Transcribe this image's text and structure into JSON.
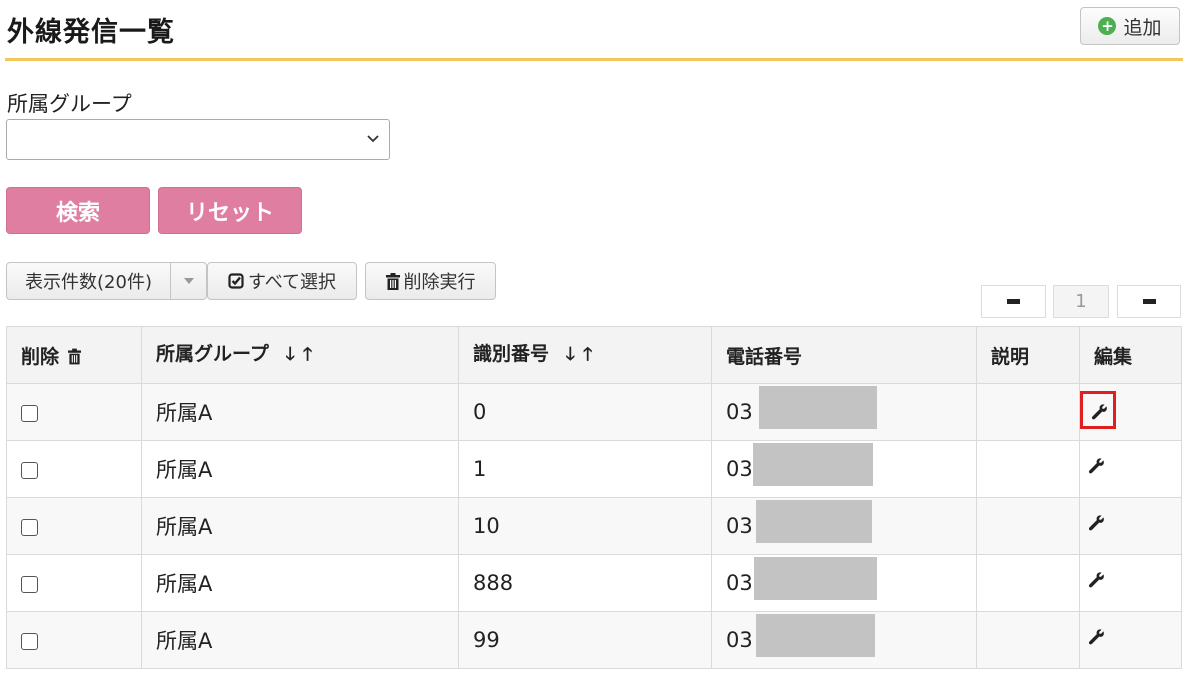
{
  "header": {
    "title": "外線発信一覧",
    "add_label": "追加"
  },
  "filter": {
    "group_label": "所属グループ",
    "group_value": ""
  },
  "actions": {
    "search_label": "検索",
    "reset_label": "リセット"
  },
  "toolbar": {
    "count_label": "表示件数(20件)",
    "select_all_label": "すべて選択",
    "delete_exec_label": "削除実行"
  },
  "pager": {
    "page": "1"
  },
  "table": {
    "headers": {
      "delete": "削除",
      "group": "所属グループ",
      "id": "識別番号",
      "phone": "電話番号",
      "desc": "説明",
      "edit": "編集"
    },
    "rows": [
      {
        "group": "所属A",
        "id": "0",
        "phone": "03",
        "desc": ""
      },
      {
        "group": "所属A",
        "id": "1",
        "phone": "03",
        "desc": ""
      },
      {
        "group": "所属A",
        "id": "10",
        "phone": "03",
        "desc": ""
      },
      {
        "group": "所属A",
        "id": "888",
        "phone": "03",
        "desc": ""
      },
      {
        "group": "所属A",
        "id": "99",
        "phone": "03",
        "desc": ""
      }
    ]
  },
  "icons": [
    "plus-circle-icon",
    "chevron-down-icon",
    "check-square-icon",
    "trash-icon",
    "wrench-icon",
    "sort-desc-icon",
    "sort-asc-icon"
  ],
  "colors": {
    "accent_rule": "#f2c75b",
    "pink_button": "#e07ea1",
    "highlight": "#e02020"
  }
}
